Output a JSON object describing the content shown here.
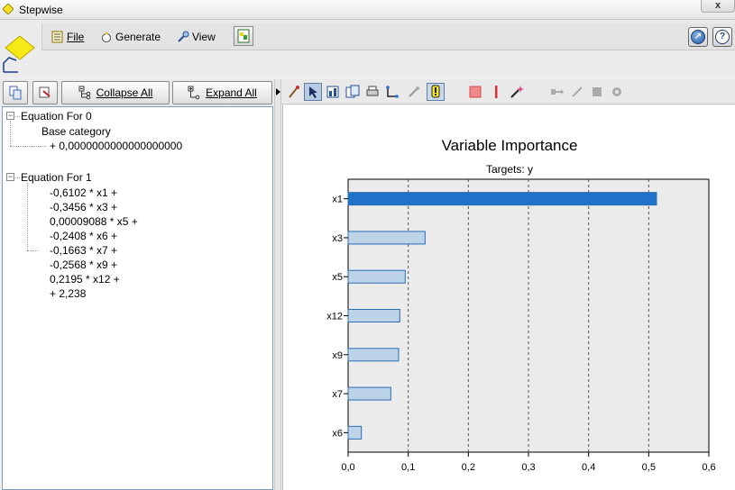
{
  "window": {
    "title": "Stepwise",
    "close_label": "x"
  },
  "menu": {
    "file": "File",
    "generate": "Generate",
    "view": "View"
  },
  "left_toolbar": {
    "collapse_all": "Collapse All",
    "expand_all": "Expand All"
  },
  "tree": {
    "eq0": {
      "label": "Equation For 0",
      "base_category": "Base category",
      "term": "+ 0,0000000000000000000"
    },
    "eq1": {
      "label": "Equation For 1",
      "terms": [
        "-0,6102 * x1 +",
        "-0,3456 * x3 +",
        "0,00009088 * x5 +",
        "-0,2408 * x6 +",
        "-0,1663 * x7 +",
        "-0,2568 * x9 +",
        "0,2195 * x12 +",
        "+ 2,238"
      ]
    }
  },
  "chart_data": {
    "type": "bar",
    "orientation": "horizontal",
    "title": "Variable Importance",
    "subtitle": "Targets: y",
    "categories": [
      "x1",
      "x3",
      "x5",
      "x12",
      "x9",
      "x7",
      "x6"
    ],
    "values": [
      0.513,
      0.128,
      0.095,
      0.086,
      0.084,
      0.071,
      0.022
    ],
    "xlim": [
      0,
      0.6
    ],
    "xticks": [
      "0,0",
      "0,1",
      "0,2",
      "0,3",
      "0,4",
      "0,5",
      "0,6"
    ],
    "grid": true,
    "colors": {
      "highlight": "#1f72c8",
      "bar": "#bcd3e8",
      "bar_border": "#2a6db5",
      "plot_bg": "#ebebeb",
      "grid": "#555555"
    }
  }
}
